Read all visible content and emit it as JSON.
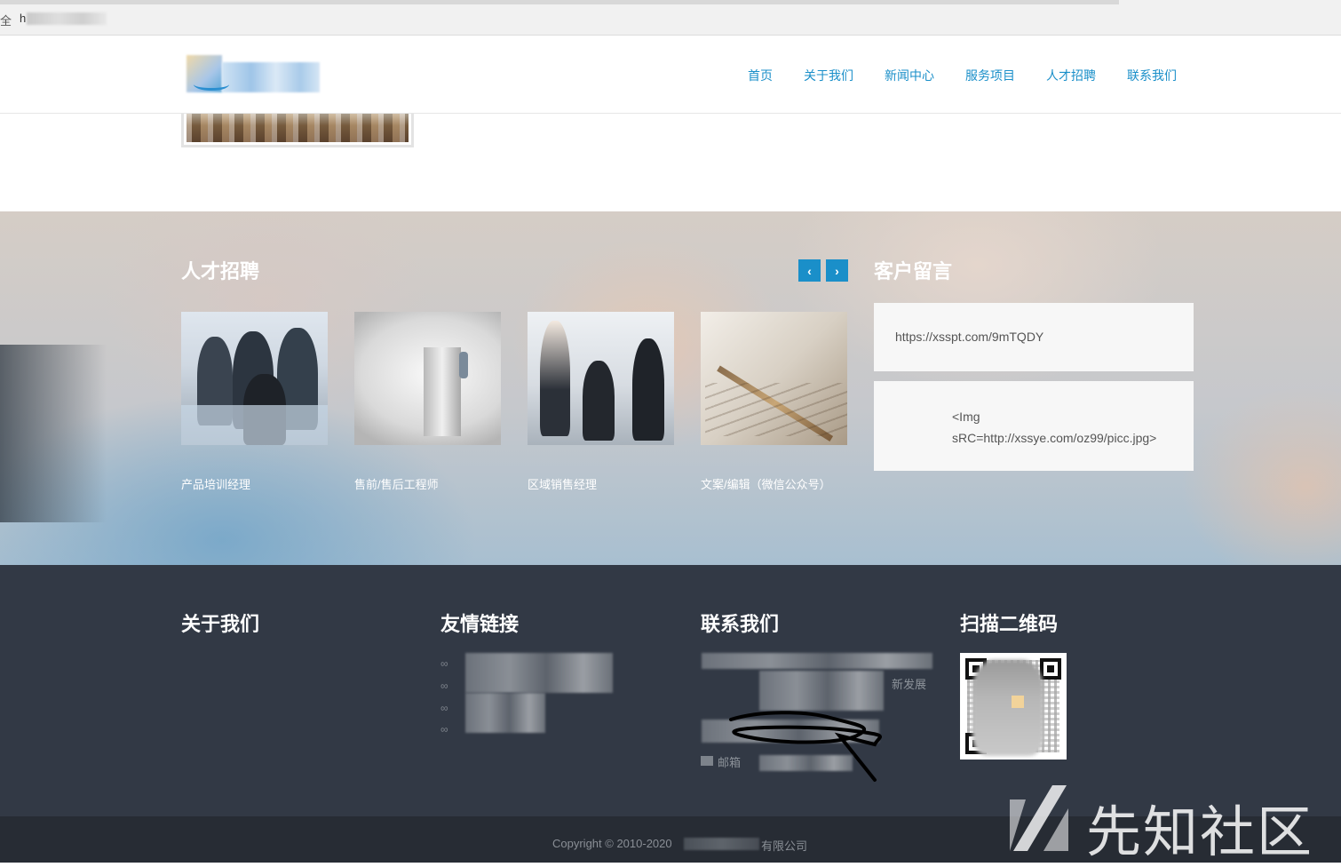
{
  "browser": {
    "security_label": "全",
    "url": "h"
  },
  "header": {
    "nav": [
      "首页",
      "关于我们",
      "新闻中心",
      "服务项目",
      "人才招聘",
      "联系我们"
    ]
  },
  "recruit": {
    "title": "人才招聘",
    "prev_icon": "chevron-left-icon",
    "next_icon": "chevron-right-icon",
    "prev_glyph": "‹",
    "next_glyph": "›",
    "jobs": [
      "产品培训经理",
      "售前/售后工程师",
      "区域销售经理",
      "文案/编辑（微信公众号）"
    ]
  },
  "messages": {
    "title": "客户留言",
    "items": [
      "https://xsspt.com/9mTQDY",
      "<Img sRC=http://xssye.com/oz99/picc.jpg>"
    ]
  },
  "footer": {
    "about_title": "关于我们",
    "links_title": "友情链接",
    "contact_title": "联系我们",
    "qr_title": "扫描二维码",
    "contact_tail": "新发展",
    "email_label": "邮箱"
  },
  "copyright": {
    "prefix": "Copyright © 2010-2020",
    "suffix": "有限公司"
  },
  "watermark": {
    "text": "先知社区"
  },
  "colors": {
    "accent": "#1a8fc9",
    "footer_bg": "#323945",
    "copyright_bg": "#272c34"
  }
}
